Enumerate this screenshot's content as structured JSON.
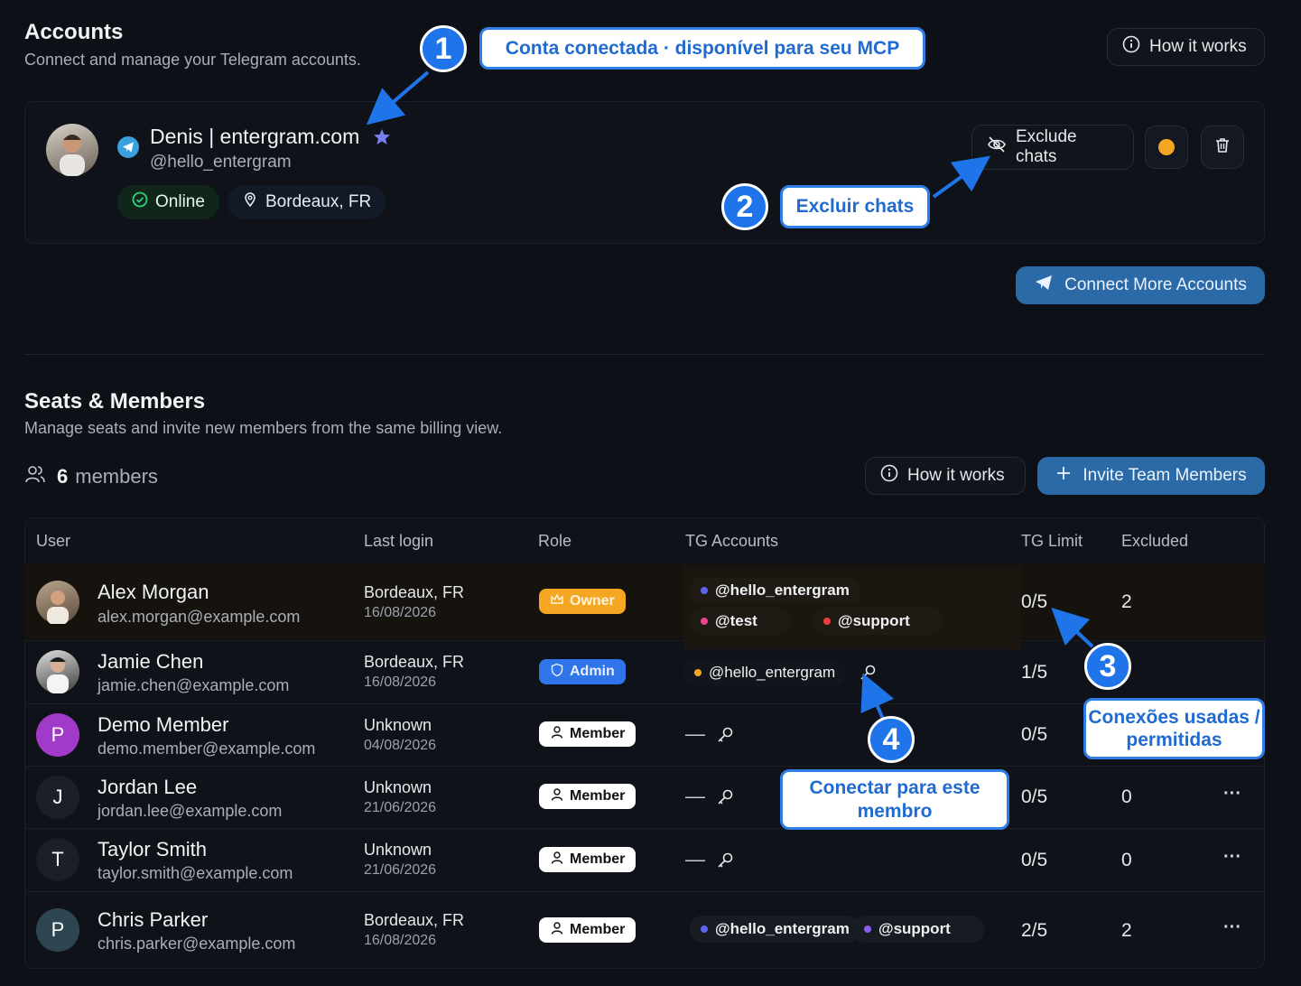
{
  "accounts": {
    "title": "Accounts",
    "subtitle": "Connect and manage your Telegram accounts.",
    "how_it_works": "How it works",
    "account": {
      "name": "Denis | entergram.com",
      "handle": "@hello_entergram",
      "status": "Online",
      "location": "Bordeaux, FR",
      "exclude_chats": "Exclude chats"
    },
    "connect_more": "Connect More Accounts"
  },
  "callouts": {
    "c1_number": "1",
    "c1_text": "Conta conectada · disponível para seu MCP",
    "c2_number": "2",
    "c2_text": "Excluir chats",
    "c3_number": "3",
    "c3_text": "Conexões usadas / permitidas",
    "c4_number": "4",
    "c4_text": "Conectar para este membro"
  },
  "seats": {
    "title": "Seats & Members",
    "subtitle": "Manage seats and invite new members from the same billing view.",
    "member_count": "6",
    "member_label": "members",
    "how_it_works": "How it works",
    "invite": "Invite Team Members"
  },
  "table": {
    "headers": [
      "User",
      "Last login",
      "Role",
      "TG Accounts",
      "TG Limit",
      "Excluded"
    ],
    "rows": [
      {
        "name": "Alex Morgan",
        "email": "alex.morgan@example.com",
        "avatar_letter": "",
        "location": "Bordeaux, FR",
        "date": "16/08/2026",
        "role": "Owner",
        "tg": [
          "@hello_entergram",
          "@test",
          "@support"
        ],
        "limit": "0/5",
        "excluded": "2",
        "more": ""
      },
      {
        "name": "Jamie Chen",
        "email": "jamie.chen@example.com",
        "avatar_letter": "",
        "location": "Bordeaux, FR",
        "date": "16/08/2026",
        "role": "Admin",
        "tg": [
          "@hello_entergram"
        ],
        "limit": "1/5",
        "excluded": "",
        "more": ""
      },
      {
        "name": "Demo Member",
        "email": "demo.member@example.com",
        "avatar_letter": "P",
        "location": "Unknown",
        "date": "04/08/2026",
        "role": "Member",
        "tg": [
          "—"
        ],
        "limit": "0/5",
        "excluded": "",
        "more": ""
      },
      {
        "name": "Jordan Lee",
        "email": "jordan.lee@example.com",
        "avatar_letter": "J",
        "location": "Unknown",
        "date": "21/06/2026",
        "role": "Member",
        "tg": [
          "—"
        ],
        "limit": "0/5",
        "excluded": "0",
        "more": "···"
      },
      {
        "name": "Taylor Smith",
        "email": "taylor.smith@example.com",
        "avatar_letter": "T",
        "location": "Unknown",
        "date": "21/06/2026",
        "role": "Member",
        "tg": [
          "—"
        ],
        "limit": "0/5",
        "excluded": "0",
        "more": "···"
      },
      {
        "name": "Chris Parker",
        "email": "chris.parker@example.com",
        "avatar_letter": "P",
        "location": "Bordeaux, FR",
        "date": "16/08/2026",
        "role": "Member",
        "tg": [
          "@hello_entergram",
          "@support"
        ],
        "limit": "2/5",
        "excluded": "2",
        "more": "···"
      }
    ]
  },
  "colors": {
    "accent_blue": "#2b6aa6",
    "online_green": "#2fd27a",
    "owner_orange": "#f5a623",
    "admin_blue": "#2f74e8",
    "callout_blue": "#1f74ea"
  }
}
